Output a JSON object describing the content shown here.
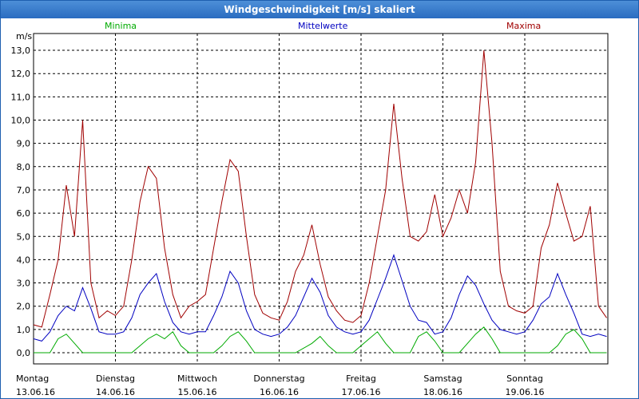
{
  "title": "Windgeschwindigkeit [m/s] skaliert",
  "colors": {
    "minima": "#00aa00",
    "mittel": "#0000c0",
    "maxima": "#a00000",
    "grid": "#000000",
    "title_bg": "#2a6cc0"
  },
  "chart_data": {
    "type": "line",
    "title": "Windgeschwindigkeit [m/s] skaliert",
    "ylabel": "m/s",
    "ylim": [
      0,
      13
    ],
    "yticks": [
      "0,0",
      "1,0",
      "2,0",
      "3,0",
      "4,0",
      "5,0",
      "6,0",
      "7,0",
      "8,0",
      "9,0",
      "10,0",
      "11,0",
      "12,0",
      "13,0"
    ],
    "xlim": [
      0,
      7
    ],
    "days": [
      {
        "name": "Montag",
        "date": "13.06.16"
      },
      {
        "name": "Dienstag",
        "date": "14.06.16"
      },
      {
        "name": "Mittwoch",
        "date": "15.06.16"
      },
      {
        "name": "Donnerstag",
        "date": "16.06.16"
      },
      {
        "name": "Freitag",
        "date": "17.06.16"
      },
      {
        "name": "Samstag",
        "date": "18.06.16"
      },
      {
        "name": "Sonntag",
        "date": "19.06.16"
      }
    ],
    "grid": true,
    "legend": "top",
    "series": [
      {
        "name": "Minima",
        "color": "#00aa00",
        "x": [
          0,
          0.1,
          0.2,
          0.3,
          0.4,
          0.5,
          0.6,
          0.7,
          0.8,
          0.9,
          1,
          1.1,
          1.2,
          1.3,
          1.4,
          1.5,
          1.6,
          1.7,
          1.8,
          1.9,
          2,
          2.1,
          2.2,
          2.3,
          2.4,
          2.5,
          2.6,
          2.7,
          2.8,
          2.9,
          3,
          3.1,
          3.2,
          3.3,
          3.4,
          3.5,
          3.6,
          3.7,
          3.8,
          3.9,
          4,
          4.1,
          4.2,
          4.3,
          4.4,
          4.5,
          4.6,
          4.7,
          4.8,
          4.9,
          5,
          5.1,
          5.2,
          5.3,
          5.4,
          5.5,
          5.6,
          5.7,
          5.8,
          5.9,
          6,
          6.1,
          6.2,
          6.3,
          6.4,
          6.5,
          6.6,
          6.7,
          6.8,
          6.9,
          7
        ],
        "y": [
          0,
          0,
          0,
          0.6,
          0.8,
          0.4,
          0,
          0,
          0,
          0,
          0,
          0,
          0,
          0.3,
          0.6,
          0.8,
          0.6,
          0.9,
          0.3,
          0,
          0,
          0,
          0,
          0.3,
          0.7,
          0.9,
          0.5,
          0,
          0,
          0,
          0,
          0,
          0,
          0.2,
          0.4,
          0.7,
          0.3,
          0,
          0,
          0,
          0.3,
          0.6,
          0.9,
          0.4,
          0,
          0,
          0,
          0.7,
          0.9,
          0.5,
          0,
          0,
          0,
          0.4,
          0.8,
          1.1,
          0.6,
          0,
          0,
          0,
          0,
          0,
          0,
          0,
          0.3,
          0.8,
          1.0,
          0.6,
          0,
          0,
          0
        ]
      },
      {
        "name": "Mittelwerte",
        "color": "#0000c0",
        "x": [
          0,
          0.1,
          0.2,
          0.3,
          0.4,
          0.5,
          0.6,
          0.7,
          0.8,
          0.9,
          1,
          1.1,
          1.2,
          1.3,
          1.4,
          1.5,
          1.6,
          1.7,
          1.8,
          1.9,
          2,
          2.1,
          2.2,
          2.3,
          2.4,
          2.5,
          2.6,
          2.7,
          2.8,
          2.9,
          3,
          3.1,
          3.2,
          3.3,
          3.4,
          3.5,
          3.6,
          3.7,
          3.8,
          3.9,
          4,
          4.1,
          4.2,
          4.3,
          4.4,
          4.5,
          4.6,
          4.7,
          4.8,
          4.9,
          5,
          5.1,
          5.2,
          5.3,
          5.4,
          5.5,
          5.6,
          5.7,
          5.8,
          5.9,
          6,
          6.1,
          6.2,
          6.3,
          6.4,
          6.5,
          6.6,
          6.7,
          6.8,
          6.9,
          7
        ],
        "y": [
          0.6,
          0.5,
          0.9,
          1.6,
          2.0,
          1.8,
          2.8,
          1.9,
          0.9,
          0.8,
          0.8,
          0.9,
          1.5,
          2.5,
          3.0,
          3.4,
          2.2,
          1.3,
          0.9,
          0.8,
          0.9,
          0.9,
          1.6,
          2.4,
          3.5,
          3.0,
          1.8,
          1.0,
          0.8,
          0.7,
          0.8,
          1.1,
          1.6,
          2.4,
          3.2,
          2.6,
          1.6,
          1.1,
          0.9,
          0.8,
          0.9,
          1.4,
          2.3,
          3.2,
          4.2,
          3.1,
          2.0,
          1.4,
          1.3,
          0.8,
          0.9,
          1.5,
          2.5,
          3.3,
          2.9,
          2.1,
          1.4,
          1.0,
          0.9,
          0.8,
          0.9,
          1.4,
          2.1,
          2.4,
          3.4,
          2.5,
          1.7,
          0.8,
          0.7,
          0.8,
          0.7
        ]
      },
      {
        "name": "Maxima",
        "color": "#a00000",
        "x": [
          0,
          0.1,
          0.2,
          0.3,
          0.4,
          0.5,
          0.6,
          0.7,
          0.8,
          0.9,
          1,
          1.1,
          1.2,
          1.3,
          1.4,
          1.5,
          1.6,
          1.7,
          1.8,
          1.9,
          2,
          2.1,
          2.2,
          2.3,
          2.4,
          2.5,
          2.6,
          2.7,
          2.8,
          2.9,
          3,
          3.1,
          3.2,
          3.3,
          3.4,
          3.5,
          3.6,
          3.7,
          3.8,
          3.9,
          4,
          4.1,
          4.2,
          4.3,
          4.4,
          4.5,
          4.6,
          4.7,
          4.8,
          4.9,
          5,
          5.1,
          5.2,
          5.3,
          5.4,
          5.5,
          5.6,
          5.7,
          5.8,
          5.9,
          6,
          6.1,
          6.2,
          6.3,
          6.4,
          6.5,
          6.6,
          6.7,
          6.8,
          6.9,
          7
        ],
        "y": [
          1.2,
          1.1,
          2.5,
          4.0,
          7.2,
          5.0,
          10.0,
          3.0,
          1.5,
          1.8,
          1.6,
          2.0,
          4.0,
          6.5,
          8.0,
          7.5,
          4.5,
          2.5,
          1.5,
          2.0,
          2.2,
          2.5,
          4.5,
          6.5,
          8.3,
          7.8,
          5.0,
          2.5,
          1.7,
          1.5,
          1.4,
          2.2,
          3.5,
          4.2,
          5.5,
          3.8,
          2.4,
          1.8,
          1.4,
          1.3,
          1.6,
          3.0,
          5.0,
          7.0,
          10.7,
          7.5,
          5.0,
          4.8,
          5.2,
          6.8,
          5.0,
          5.8,
          7.0,
          6.0,
          8.2,
          13.0,
          9.0,
          3.5,
          2.0,
          1.8,
          1.7,
          2.0,
          4.5,
          5.5,
          7.3,
          6.0,
          4.8,
          5.0,
          6.3,
          2.0,
          1.5
        ]
      }
    ]
  }
}
